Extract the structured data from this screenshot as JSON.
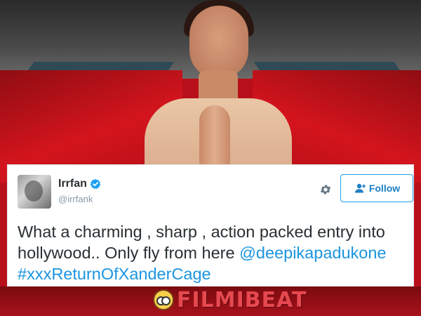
{
  "tweet": {
    "user_name": "Irrfan",
    "user_handle": "@irrfank",
    "follow_label": "Follow",
    "text": "What a charming , sharp , action packed entry into hollywood.. Only fly from here",
    "mention": "@deepikapadukone",
    "hashtag": "#xxxReturnOfXanderCage"
  },
  "icons": {
    "verified": "verified-badge-icon",
    "settings": "gear-icon",
    "follow": "add-user-icon"
  },
  "watermark": {
    "text": "FILMIBEAT"
  },
  "colors": {
    "link": "#1b95e0",
    "follow_border": "#1da1f2",
    "text": "#292f33",
    "handle": "#8899a6"
  }
}
